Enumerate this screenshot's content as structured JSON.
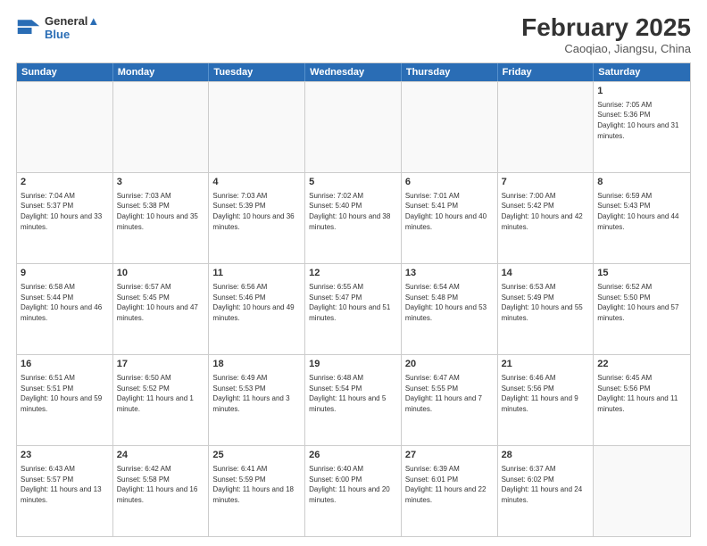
{
  "header": {
    "logo_line1": "General",
    "logo_line2": "Blue",
    "month": "February 2025",
    "location": "Caoqiao, Jiangsu, China"
  },
  "weekdays": [
    "Sunday",
    "Monday",
    "Tuesday",
    "Wednesday",
    "Thursday",
    "Friday",
    "Saturday"
  ],
  "weeks": [
    [
      {
        "day": "",
        "info": "",
        "empty": true
      },
      {
        "day": "",
        "info": "",
        "empty": true
      },
      {
        "day": "",
        "info": "",
        "empty": true
      },
      {
        "day": "",
        "info": "",
        "empty": true
      },
      {
        "day": "",
        "info": "",
        "empty": true
      },
      {
        "day": "",
        "info": "",
        "empty": true
      },
      {
        "day": "1",
        "info": "Sunrise: 7:05 AM\nSunset: 5:36 PM\nDaylight: 10 hours and 31 minutes.",
        "empty": false
      }
    ],
    [
      {
        "day": "2",
        "info": "Sunrise: 7:04 AM\nSunset: 5:37 PM\nDaylight: 10 hours and 33 minutes.",
        "empty": false
      },
      {
        "day": "3",
        "info": "Sunrise: 7:03 AM\nSunset: 5:38 PM\nDaylight: 10 hours and 35 minutes.",
        "empty": false
      },
      {
        "day": "4",
        "info": "Sunrise: 7:03 AM\nSunset: 5:39 PM\nDaylight: 10 hours and 36 minutes.",
        "empty": false
      },
      {
        "day": "5",
        "info": "Sunrise: 7:02 AM\nSunset: 5:40 PM\nDaylight: 10 hours and 38 minutes.",
        "empty": false
      },
      {
        "day": "6",
        "info": "Sunrise: 7:01 AM\nSunset: 5:41 PM\nDaylight: 10 hours and 40 minutes.",
        "empty": false
      },
      {
        "day": "7",
        "info": "Sunrise: 7:00 AM\nSunset: 5:42 PM\nDaylight: 10 hours and 42 minutes.",
        "empty": false
      },
      {
        "day": "8",
        "info": "Sunrise: 6:59 AM\nSunset: 5:43 PM\nDaylight: 10 hours and 44 minutes.",
        "empty": false
      }
    ],
    [
      {
        "day": "9",
        "info": "Sunrise: 6:58 AM\nSunset: 5:44 PM\nDaylight: 10 hours and 46 minutes.",
        "empty": false
      },
      {
        "day": "10",
        "info": "Sunrise: 6:57 AM\nSunset: 5:45 PM\nDaylight: 10 hours and 47 minutes.",
        "empty": false
      },
      {
        "day": "11",
        "info": "Sunrise: 6:56 AM\nSunset: 5:46 PM\nDaylight: 10 hours and 49 minutes.",
        "empty": false
      },
      {
        "day": "12",
        "info": "Sunrise: 6:55 AM\nSunset: 5:47 PM\nDaylight: 10 hours and 51 minutes.",
        "empty": false
      },
      {
        "day": "13",
        "info": "Sunrise: 6:54 AM\nSunset: 5:48 PM\nDaylight: 10 hours and 53 minutes.",
        "empty": false
      },
      {
        "day": "14",
        "info": "Sunrise: 6:53 AM\nSunset: 5:49 PM\nDaylight: 10 hours and 55 minutes.",
        "empty": false
      },
      {
        "day": "15",
        "info": "Sunrise: 6:52 AM\nSunset: 5:50 PM\nDaylight: 10 hours and 57 minutes.",
        "empty": false
      }
    ],
    [
      {
        "day": "16",
        "info": "Sunrise: 6:51 AM\nSunset: 5:51 PM\nDaylight: 10 hours and 59 minutes.",
        "empty": false
      },
      {
        "day": "17",
        "info": "Sunrise: 6:50 AM\nSunset: 5:52 PM\nDaylight: 11 hours and 1 minute.",
        "empty": false
      },
      {
        "day": "18",
        "info": "Sunrise: 6:49 AM\nSunset: 5:53 PM\nDaylight: 11 hours and 3 minutes.",
        "empty": false
      },
      {
        "day": "19",
        "info": "Sunrise: 6:48 AM\nSunset: 5:54 PM\nDaylight: 11 hours and 5 minutes.",
        "empty": false
      },
      {
        "day": "20",
        "info": "Sunrise: 6:47 AM\nSunset: 5:55 PM\nDaylight: 11 hours and 7 minutes.",
        "empty": false
      },
      {
        "day": "21",
        "info": "Sunrise: 6:46 AM\nSunset: 5:56 PM\nDaylight: 11 hours and 9 minutes.",
        "empty": false
      },
      {
        "day": "22",
        "info": "Sunrise: 6:45 AM\nSunset: 5:56 PM\nDaylight: 11 hours and 11 minutes.",
        "empty": false
      }
    ],
    [
      {
        "day": "23",
        "info": "Sunrise: 6:43 AM\nSunset: 5:57 PM\nDaylight: 11 hours and 13 minutes.",
        "empty": false
      },
      {
        "day": "24",
        "info": "Sunrise: 6:42 AM\nSunset: 5:58 PM\nDaylight: 11 hours and 16 minutes.",
        "empty": false
      },
      {
        "day": "25",
        "info": "Sunrise: 6:41 AM\nSunset: 5:59 PM\nDaylight: 11 hours and 18 minutes.",
        "empty": false
      },
      {
        "day": "26",
        "info": "Sunrise: 6:40 AM\nSunset: 6:00 PM\nDaylight: 11 hours and 20 minutes.",
        "empty": false
      },
      {
        "day": "27",
        "info": "Sunrise: 6:39 AM\nSunset: 6:01 PM\nDaylight: 11 hours and 22 minutes.",
        "empty": false
      },
      {
        "day": "28",
        "info": "Sunrise: 6:37 AM\nSunset: 6:02 PM\nDaylight: 11 hours and 24 minutes.",
        "empty": false
      },
      {
        "day": "",
        "info": "",
        "empty": true
      }
    ]
  ]
}
